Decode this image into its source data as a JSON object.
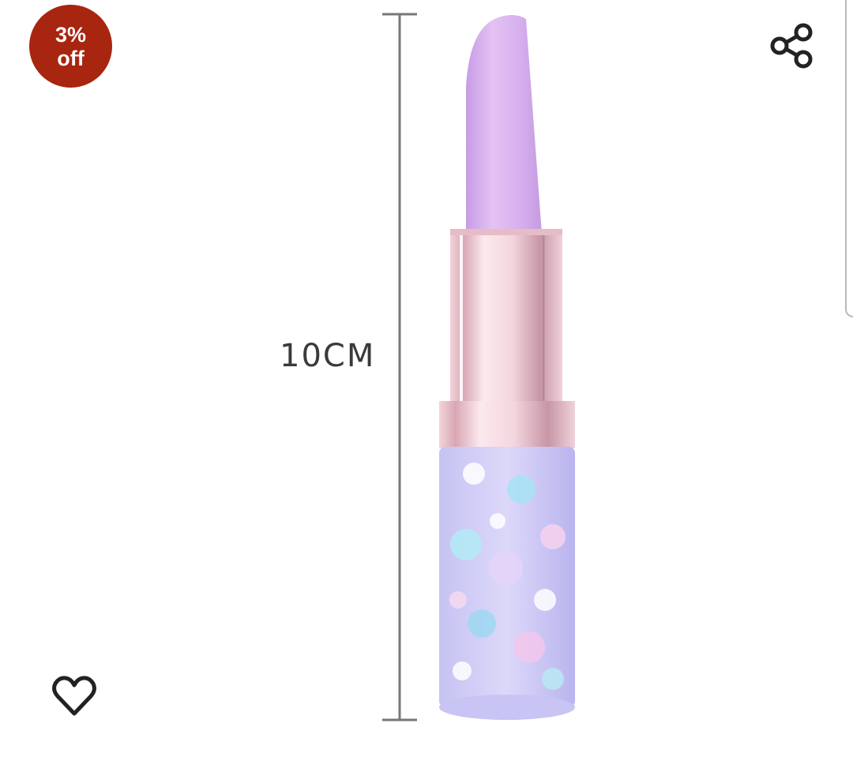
{
  "discount": {
    "line1": "3%",
    "line2": "off"
  },
  "product_image": {
    "measurement_label": "10CM"
  },
  "icons": {
    "share": "share-icon",
    "wishlist": "heart-outline-icon"
  },
  "colors": {
    "badge": "#a8250f",
    "lipstick_bullet": "#d8a8ee",
    "icon": "#222222"
  }
}
